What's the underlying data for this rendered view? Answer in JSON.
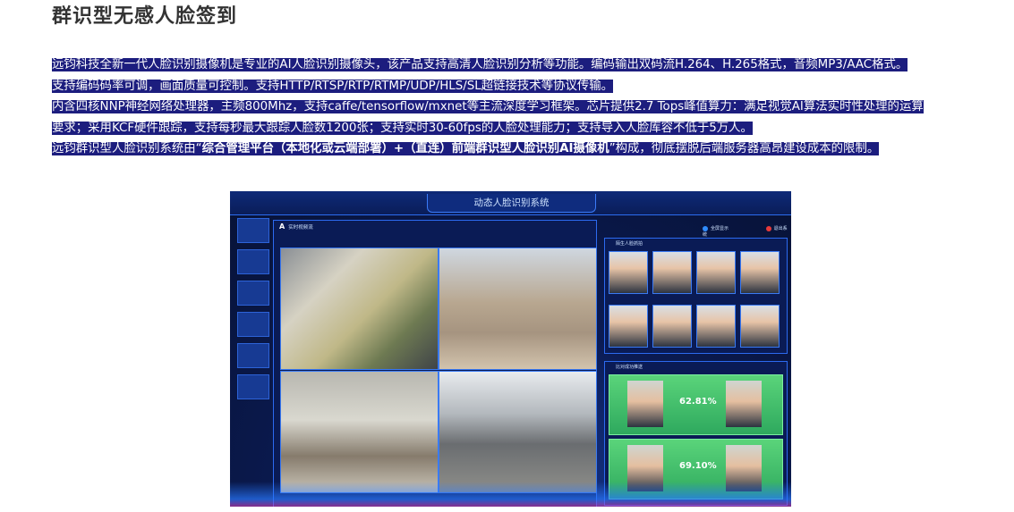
{
  "page": {
    "title": "群识型无感人脸签到",
    "paragraph": {
      "line1": "远钧科技全新一代人脸识别摄像机是专业的AI人脸识别摄像头，该产品支持高清人脸识别分析等功能。编码输出双码流H.264、H.265格式，音频MP3/AAC格式。",
      "line2": "支持编码码率可调，画面质量可控制。支持HTTP/RTSP/RTP/RTMP/UDP/HLS/SL超链接技术等协议传输。",
      "line3": "内含四核NNP神经网络处理器，主频800Mhz，支持caffe/tensorflow/mxnet等主流深度学习框架。芯片提供2.7 Tops峰值算力：满足视觉AI算法实时性处理的运算",
      "line4": "要求；采用KCF硬件跟踪，支持每秒最大跟踪人脸数1200张；支持实时30-60fps的人脸处理能力；支持导入人脸库容不低于5万人。",
      "line5_prefix": "远钧群识型人脸识别系统由“",
      "line5_bold": "综合管理平台（本地化或云端部署）+（直连）前端群识型人脸识别AI摄像机",
      "line5_suffix": "”构成，彻底摆脱后端服务器高昂建设成本的限制。"
    }
  },
  "screenshot": {
    "system_title": "动态人脸识别系统",
    "video_panel_letter": "A",
    "video_panel_title": "实时视频流",
    "faces_panel_title": "陌生人脸抓拍",
    "compare_panel_title": "比对成功推送",
    "btn_fullscreen": "全屏显示",
    "btn_exit": "退出系统",
    "match1": "62.81%",
    "match2": "69.10%",
    "colors": {
      "highlight_bg": "#1c1d7e",
      "accent": "#2c6af0"
    }
  }
}
